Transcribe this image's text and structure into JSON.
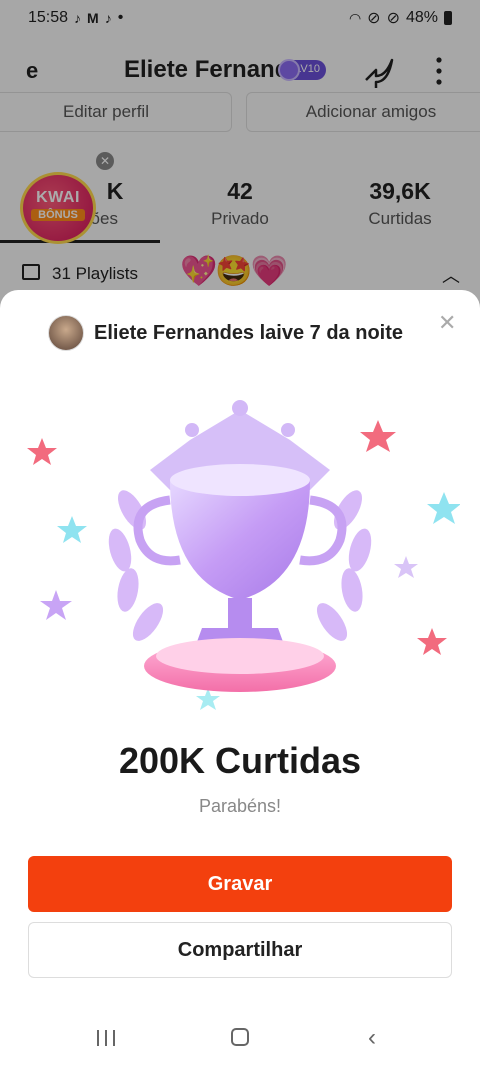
{
  "status_bar": {
    "time": "15:58",
    "battery": "48%"
  },
  "header": {
    "back_label": "e",
    "profile_name": "Eliete Fernandes",
    "level_badge": "LV10"
  },
  "profile_buttons": {
    "edit": "Editar perfil",
    "add_friends": "Adicionar amigos"
  },
  "stats": [
    {
      "num": "K",
      "label": "ções"
    },
    {
      "num": "42",
      "label": "Privado"
    },
    {
      "num": "39,6K",
      "label": "Curtidas"
    }
  ],
  "kwai_bonus": {
    "line1": "KWAI",
    "line2": "BÔNUS"
  },
  "playlists": {
    "label": "31 Playlists",
    "emojis": "💖🤩💗"
  },
  "sheet": {
    "title": "Eliete Fernandes laive 7 da noite",
    "headline": "200K Curtidas",
    "subline": "Parabéns!",
    "primary_button": "Gravar",
    "secondary_button": "Compartilhar"
  },
  "colors": {
    "accent": "#f3400e",
    "level_badge": "#6a4fd8"
  },
  "icons": [
    "tiktok-icon",
    "gmail-icon",
    "wifi-icon",
    "do-not-disturb-icon",
    "battery-icon",
    "share-icon",
    "more-icon",
    "playlist-icon",
    "chevron-up-icon",
    "close-icon",
    "trophy-icon",
    "nav-recent-icon",
    "nav-home-icon",
    "nav-back-icon"
  ]
}
